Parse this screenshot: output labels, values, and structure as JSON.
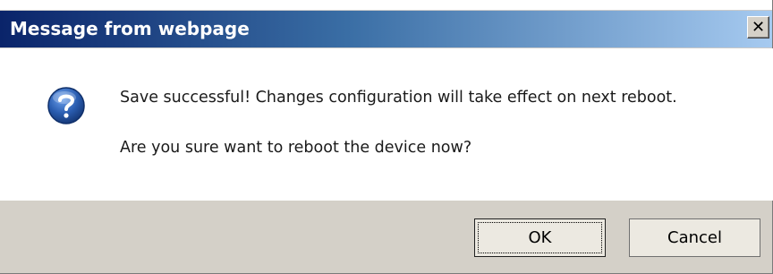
{
  "dialog": {
    "title": "Message from webpage",
    "close_label": "✕",
    "icon": "question-icon",
    "message_line1": "Save successful! Changes configuration will take effect on next reboot.",
    "message_line2": "Are you sure want to reboot the device now?",
    "ok_label": "OK",
    "cancel_label": "Cancel"
  },
  "colors": {
    "title_start": "#0a246a",
    "title_end": "#a6caf0",
    "footer": "#d4d0c8",
    "icon_blue": "#2a5db0"
  }
}
